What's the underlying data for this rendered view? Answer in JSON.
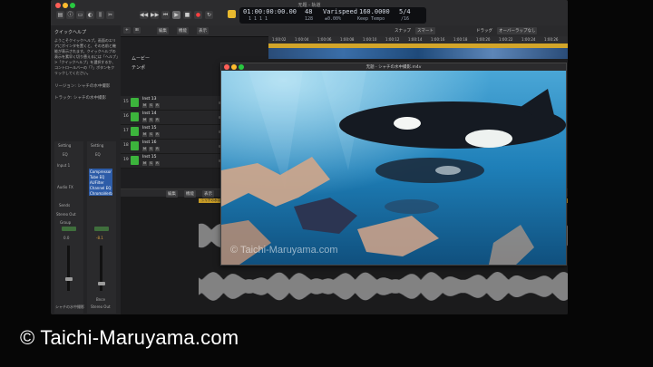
{
  "window": {
    "title": "无题 - 轨道"
  },
  "lcd": {
    "position_time": "01:00:00:00.00",
    "position_bars": "1  1  1   1",
    "tempo_top": "48",
    "tempo_sub": "128",
    "varispeed_label": "Varispeed",
    "varispeed_value": "±0.00%",
    "bpm": "160.0000",
    "keep_tempo": "Keep Tempo",
    "signature": "5/4",
    "division": "/16"
  },
  "inspector": {
    "title": "クイックヘルプ",
    "help_text": "ようこそクイックヘルプ。画面のエリアにポインタを置くと、その名前と機能が表示されます。クイックヘルプの表示を素早く切り替えるには「ヘルプ」>「クイックヘルプ」を選択するか、コントロールバーの「?」ボタンをクリックしてください。",
    "region_label": "リージョン: シャチの水中撮影",
    "track_label": "トラック: シャチの水中撮影",
    "setting": "Setting",
    "eq": "EQ",
    "input": "Input 1",
    "audio_fx": "Audio FX",
    "sends": "Sends",
    "stereo_out": "Stereo Out",
    "group": "Group",
    "read": "Read",
    "ch1_vol": "0.0",
    "ch2_vol": "-8.1",
    "bnce": "Bnce",
    "plugins": [
      "Compressor",
      "Tube EQ",
      "AUFilter",
      "Channel EQ",
      "ChromaVerb"
    ],
    "ch1_name": "シャチの水中撮影",
    "ch2_name": "Stereo Out"
  },
  "track_area": {
    "edit_menu": "編集",
    "function_menu": "機能",
    "view_menu": "表示",
    "snap_label": "スナップ",
    "snap_value": "スマート",
    "drag_label": "ドラッグ",
    "drag_value": "オーバーラップなし",
    "movie_track": "ムービー",
    "tempo_track": "テンポ"
  },
  "ruler_ticks": [
    "1:00:02",
    "1:00:04",
    "1:00:06",
    "1:00:08",
    "1:00:10",
    "1:00:12",
    "1:00:14",
    "1:00:16",
    "1:00:18",
    "1:00:20",
    "1:00:22",
    "1:00:24",
    "1:00:26"
  ],
  "tracks": [
    {
      "num": "15",
      "name": "Inst 13"
    },
    {
      "num": "16",
      "name": "Inst 14"
    },
    {
      "num": "17",
      "name": "Inst 15"
    },
    {
      "num": "18",
      "name": "Inst 16"
    },
    {
      "num": "19",
      "name": "Inst 15"
    }
  ],
  "editor": {
    "edit_menu": "編集",
    "function_menu": "機能",
    "view_menu": "表示",
    "region_name": "シャチの水中撮影"
  },
  "movie": {
    "title": "无题 - シャチの水中撮影.m4v",
    "watermark": "© Taichi-Maruyama.com"
  },
  "watermark": "© Taichi-Maruyama.com",
  "colors": {
    "accent_green": "#3cb43c",
    "cycle_yellow": "#d2a52a",
    "lcd_bg": "#0e0f12"
  }
}
